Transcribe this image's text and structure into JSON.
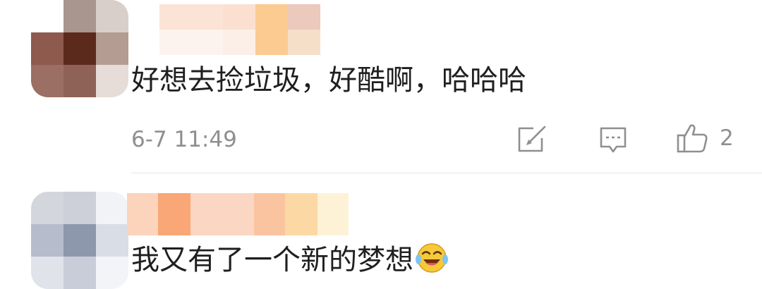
{
  "comments": [
    {
      "text": "好想去捡垃圾，好酷啊，哈哈哈",
      "timestamp": "6-7 11:49",
      "like_count": "2",
      "icons": [
        "edit-icon",
        "reply-icon",
        "thumbs-up-icon"
      ]
    },
    {
      "text": "我又有了一个新的梦想",
      "emoji_icon": "laughing-crying-emoji"
    }
  ]
}
